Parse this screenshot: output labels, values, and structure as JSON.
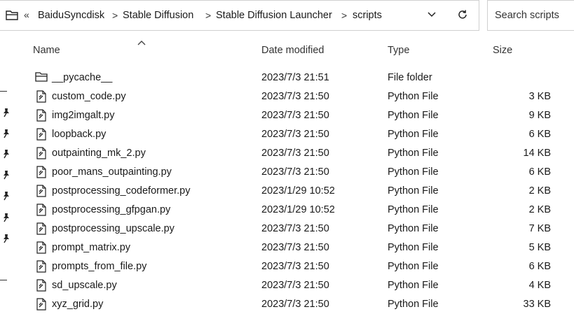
{
  "address_bar": {
    "overflow": "«",
    "breadcrumbs": [
      "BaiduSyncdisk",
      "Stable Diffusion",
      "Stable Diffusion Launcher",
      "scripts"
    ],
    "separator": ">"
  },
  "search": {
    "placeholder": "Search scripts"
  },
  "columns": {
    "name": "Name",
    "date": "Date modified",
    "type": "Type",
    "size": "Size",
    "sort_column": "name",
    "sort_direction": "ascending"
  },
  "files": [
    {
      "name": "__pycache__",
      "date": "2023/7/3 21:51",
      "type": "File folder",
      "size": "",
      "icon": "folder-icon"
    },
    {
      "name": "custom_code.py",
      "date": "2023/7/3 21:50",
      "type": "Python File",
      "size": "3 KB",
      "icon": "python-file-icon"
    },
    {
      "name": "img2imgalt.py",
      "date": "2023/7/3 21:50",
      "type": "Python File",
      "size": "9 KB",
      "icon": "python-file-icon"
    },
    {
      "name": "loopback.py",
      "date": "2023/7/3 21:50",
      "type": "Python File",
      "size": "6 KB",
      "icon": "python-file-icon"
    },
    {
      "name": "outpainting_mk_2.py",
      "date": "2023/7/3 21:50",
      "type": "Python File",
      "size": "14 KB",
      "icon": "python-file-icon"
    },
    {
      "name": "poor_mans_outpainting.py",
      "date": "2023/7/3 21:50",
      "type": "Python File",
      "size": "6 KB",
      "icon": "python-file-icon"
    },
    {
      "name": "postprocessing_codeformer.py",
      "date": "2023/1/29 10:52",
      "type": "Python File",
      "size": "2 KB",
      "icon": "python-file-icon"
    },
    {
      "name": "postprocessing_gfpgan.py",
      "date": "2023/1/29 10:52",
      "type": "Python File",
      "size": "2 KB",
      "icon": "python-file-icon"
    },
    {
      "name": "postprocessing_upscale.py",
      "date": "2023/7/3 21:50",
      "type": "Python File",
      "size": "7 KB",
      "icon": "python-file-icon"
    },
    {
      "name": "prompt_matrix.py",
      "date": "2023/7/3 21:50",
      "type": "Python File",
      "size": "5 KB",
      "icon": "python-file-icon"
    },
    {
      "name": "prompts_from_file.py",
      "date": "2023/7/3 21:50",
      "type": "Python File",
      "size": "6 KB",
      "icon": "python-file-icon"
    },
    {
      "name": "sd_upscale.py",
      "date": "2023/7/3 21:50",
      "type": "Python File",
      "size": "4 KB",
      "icon": "python-file-icon"
    },
    {
      "name": "xyz_grid.py",
      "date": "2023/7/3 21:50",
      "type": "Python File",
      "size": "33 KB",
      "icon": "python-file-icon"
    }
  ],
  "nav_pane": {
    "pinned_icon": "pin-icon",
    "pinned_count": 7
  }
}
